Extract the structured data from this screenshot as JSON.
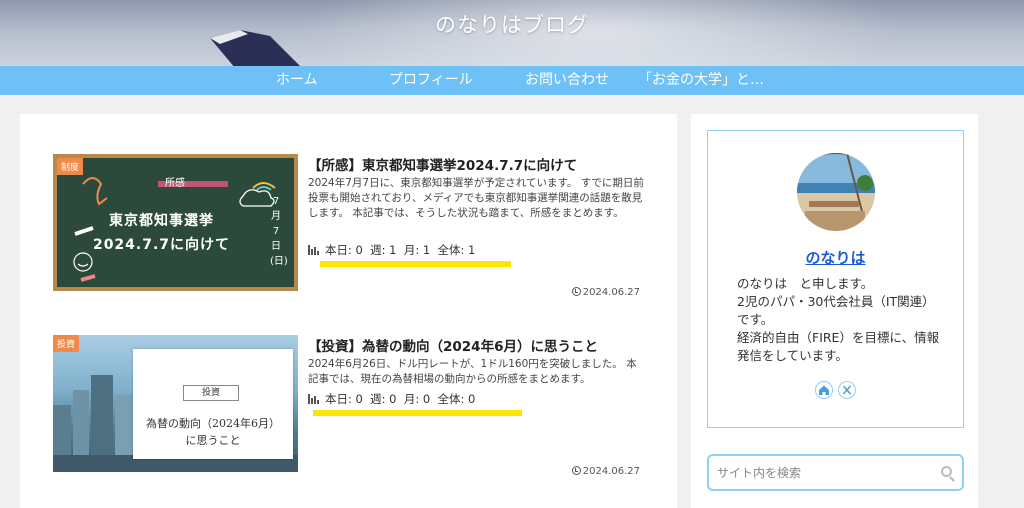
{
  "site": {
    "title": "のなりはブログ"
  },
  "nav": {
    "items": [
      "ホーム",
      "プロフィール",
      "お問い合わせ",
      "「お金の大学」と…"
    ]
  },
  "colors": {
    "nav_bg": "#6ec1f6",
    "accent_border": "#8fd0f5",
    "badge": "#f08a4b",
    "highlight": "#ffe600",
    "author_link": "#1a5bd8"
  },
  "posts": [
    {
      "category": "制度",
      "title": "【所感】東京都知事選挙2024.7.7に向けて",
      "excerpt": "2024年7月7日に、東京都知事選挙が予定されています。 すでに期日前投票も開始されており、メディアでも東京都知事選挙関連の話題を散見します。 本記事では、そうした状況も踏まて、所感をまとめます。",
      "stats": "本日: 0  週: 1  月: 1  全体: 1",
      "date": "2024.06.27",
      "thumb": {
        "tag": "所感",
        "line1": "東京都知事選挙",
        "line2": "2024.7.7に向けて",
        "side": "7 月 7 日 (日)"
      }
    },
    {
      "category": "投資",
      "title": "【投資】為替の動向（2024年6月）に思うこと",
      "excerpt": "2024年6月26日、ドル円レートが、1ドル160円を突破しました。 本記事では、現在の為替相場の動向からの所感をまとめます。",
      "stats": "本日: 0  週: 0  月: 0  全体: 0",
      "date": "2024.06.27",
      "thumb": {
        "tag": "投資",
        "line1": "為替の動向（2024年6月）",
        "line2": "に思うこと"
      }
    }
  ],
  "sidebar": {
    "author": "のなりは",
    "bio": [
      "のなりは　と申します。",
      "2児のパパ・30代会社員（IT関連）です。",
      "経済的自由（FIRE）を目標に、情報発信をしています。"
    ],
    "social_icons": [
      "home-icon",
      "x-icon"
    ],
    "search_placeholder": "サイト内を検索"
  }
}
